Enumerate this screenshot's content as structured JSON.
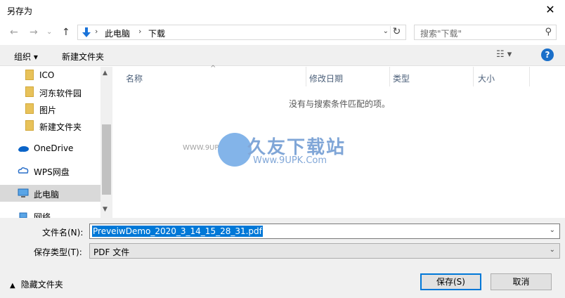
{
  "window": {
    "title": "另存为"
  },
  "nav": {
    "back": "←",
    "forward": "→",
    "up": "↑",
    "expand": "⌄"
  },
  "address": {
    "crumbs": [
      "此电脑",
      "下载"
    ],
    "separator": "›"
  },
  "search": {
    "placeholder": "搜索\"下载\""
  },
  "toolbar": {
    "organize": "组织 ▾",
    "new_folder": "新建文件夹",
    "view": "☷ ▾",
    "help": "?"
  },
  "sidebar": {
    "items": [
      {
        "label": "ICO"
      },
      {
        "label": "河东软件园"
      },
      {
        "label": "图片"
      },
      {
        "label": "新建文件夹"
      },
      {
        "label": "OneDrive"
      },
      {
        "label": "WPS网盘"
      },
      {
        "label": "此电脑"
      },
      {
        "label": "网络"
      }
    ]
  },
  "filelist": {
    "columns": [
      "名称",
      "修改日期",
      "类型",
      "大小"
    ],
    "empty_message": "没有与搜索条件匹配的项。"
  },
  "watermark": {
    "brand": "久友下载站",
    "url": "Www.9UPK.Com",
    "side": "WWW.9UPK.Com"
  },
  "form": {
    "filename_label": "文件名(N):",
    "filename_value": "PreveiwDemo_2020_3_14_15_28_31.pdf",
    "filetype_label": "保存类型(T):",
    "filetype_value": "PDF 文件"
  },
  "footer": {
    "hide_folders": "隐藏文件夹",
    "save": "保存(S)",
    "cancel": "取消"
  },
  "colors": {
    "accent": "#0078d7",
    "folder": "#e8c25a",
    "help": "#1a6fc9"
  }
}
